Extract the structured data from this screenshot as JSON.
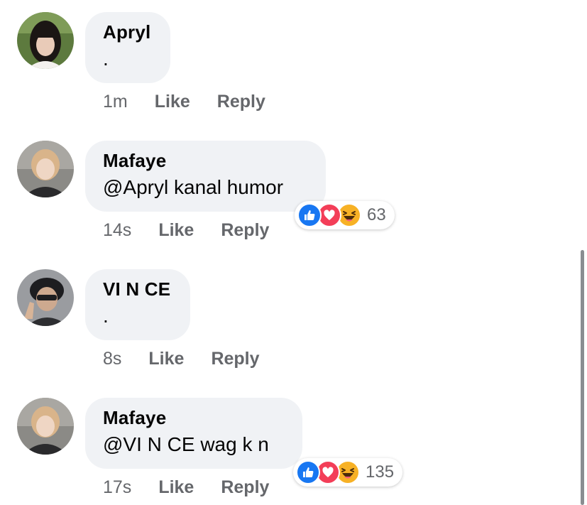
{
  "comments": [
    {
      "author": "Apryl",
      "text": ".",
      "time": "1m",
      "like_label": "Like",
      "reply_label": "Reply"
    },
    {
      "author": "Mafaye",
      "text": "@Apryl kanal humor",
      "time": "14s",
      "like_label": "Like",
      "reply_label": "Reply",
      "reactions": {
        "icons": [
          "like-icon",
          "love-icon",
          "haha-icon"
        ],
        "count": "63"
      }
    },
    {
      "author": "VI N CE",
      "text": ".",
      "time": "8s",
      "like_label": "Like",
      "reply_label": "Reply"
    },
    {
      "author": "Mafaye",
      "text": "@VI N CE wag k n",
      "time": "17s",
      "like_label": "Like",
      "reply_label": "Reply",
      "reactions": {
        "icons": [
          "like-icon",
          "love-icon",
          "haha-icon"
        ],
        "count": "135"
      }
    }
  ],
  "colors": {
    "bubble": "#f0f2f5",
    "meta_text": "#65676b",
    "like": "#1877f2",
    "love": "#f33e58",
    "haha": "#f7b125"
  }
}
